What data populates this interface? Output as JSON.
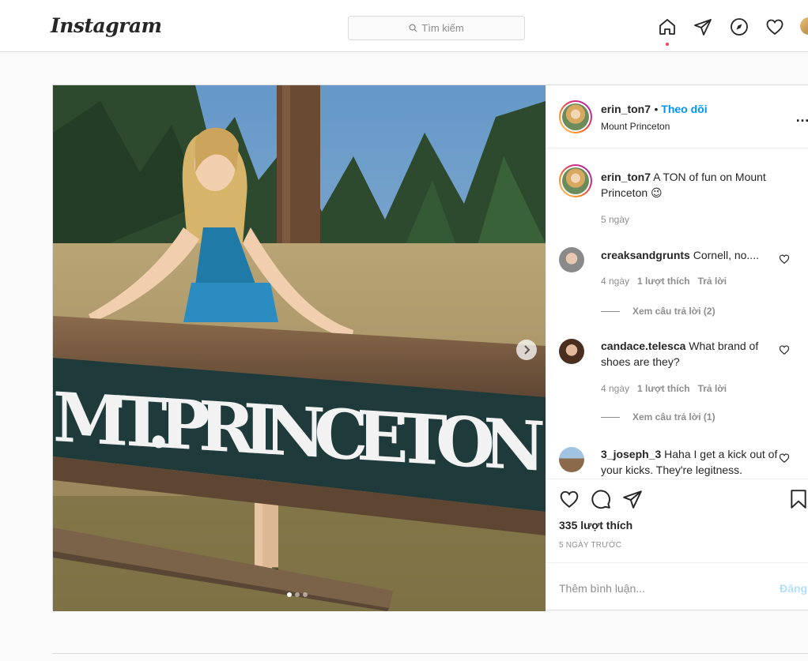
{
  "header": {
    "logo": "Instagram",
    "search_placeholder": "Tìm kiếm",
    "nav_icons": [
      "home-icon",
      "direct-icon",
      "explore-icon",
      "activity-heart-icon",
      "profile-avatar"
    ]
  },
  "post": {
    "sign_text": "MT.PRINCETON",
    "carousel_dots": 3,
    "active_dot": 0,
    "user": "erin_ton7",
    "follow_label": "Theo dõi",
    "location": "Mount Princeton",
    "caption_user": "erin_ton7",
    "caption_text": "A TON of fun on Mount Princeton 😉",
    "caption_time": "5 ngày",
    "comments": [
      {
        "user": "creaksandgrunts",
        "text": "Cornell, no....",
        "time": "4 ngày",
        "likes": "1 lượt thích",
        "reply": "Trả lời",
        "view_replies": "Xem câu trả lời (2)"
      },
      {
        "user": "candace.telesca",
        "text": "What brand of shoes are they?",
        "time": "4 ngày",
        "likes": "1 lượt thích",
        "reply": "Trả lời",
        "view_replies": "Xem câu trả lời (1)"
      },
      {
        "user": "3_joseph_3",
        "text": "Haha I get a kick out of your kicks. They're legitness."
      }
    ],
    "like_count": "335 lượt thích",
    "posted_ago": "5 NGÀY TRƯỚC",
    "add_comment_placeholder": "Thêm bình luận...",
    "post_button": "Đăng"
  },
  "colors": {
    "accent_blue": "#0095f6",
    "border": "#dbdbdb",
    "muted": "#8e8e8e"
  }
}
